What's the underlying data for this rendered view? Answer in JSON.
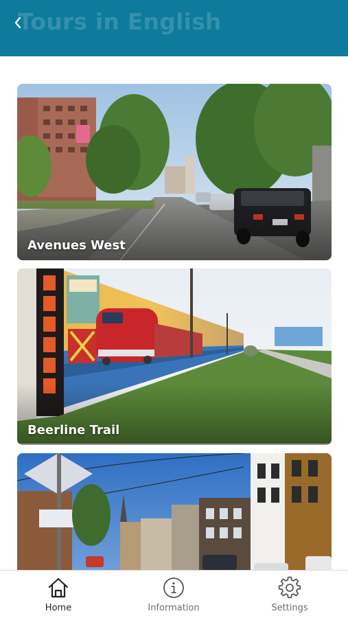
{
  "header": {
    "title": "Tours in English",
    "back_icon": "chevron-left-icon",
    "background": "#0e7a9c"
  },
  "tours": [
    {
      "label": "Avenues West"
    },
    {
      "label": "Beerline Trail"
    },
    {
      "label": ""
    }
  ],
  "tabbar": {
    "items": [
      {
        "label": "Home",
        "icon": "home-icon",
        "active": true
      },
      {
        "label": "Information",
        "icon": "info-icon",
        "active": false
      },
      {
        "label": "Settings",
        "icon": "gear-icon",
        "active": false
      }
    ]
  }
}
